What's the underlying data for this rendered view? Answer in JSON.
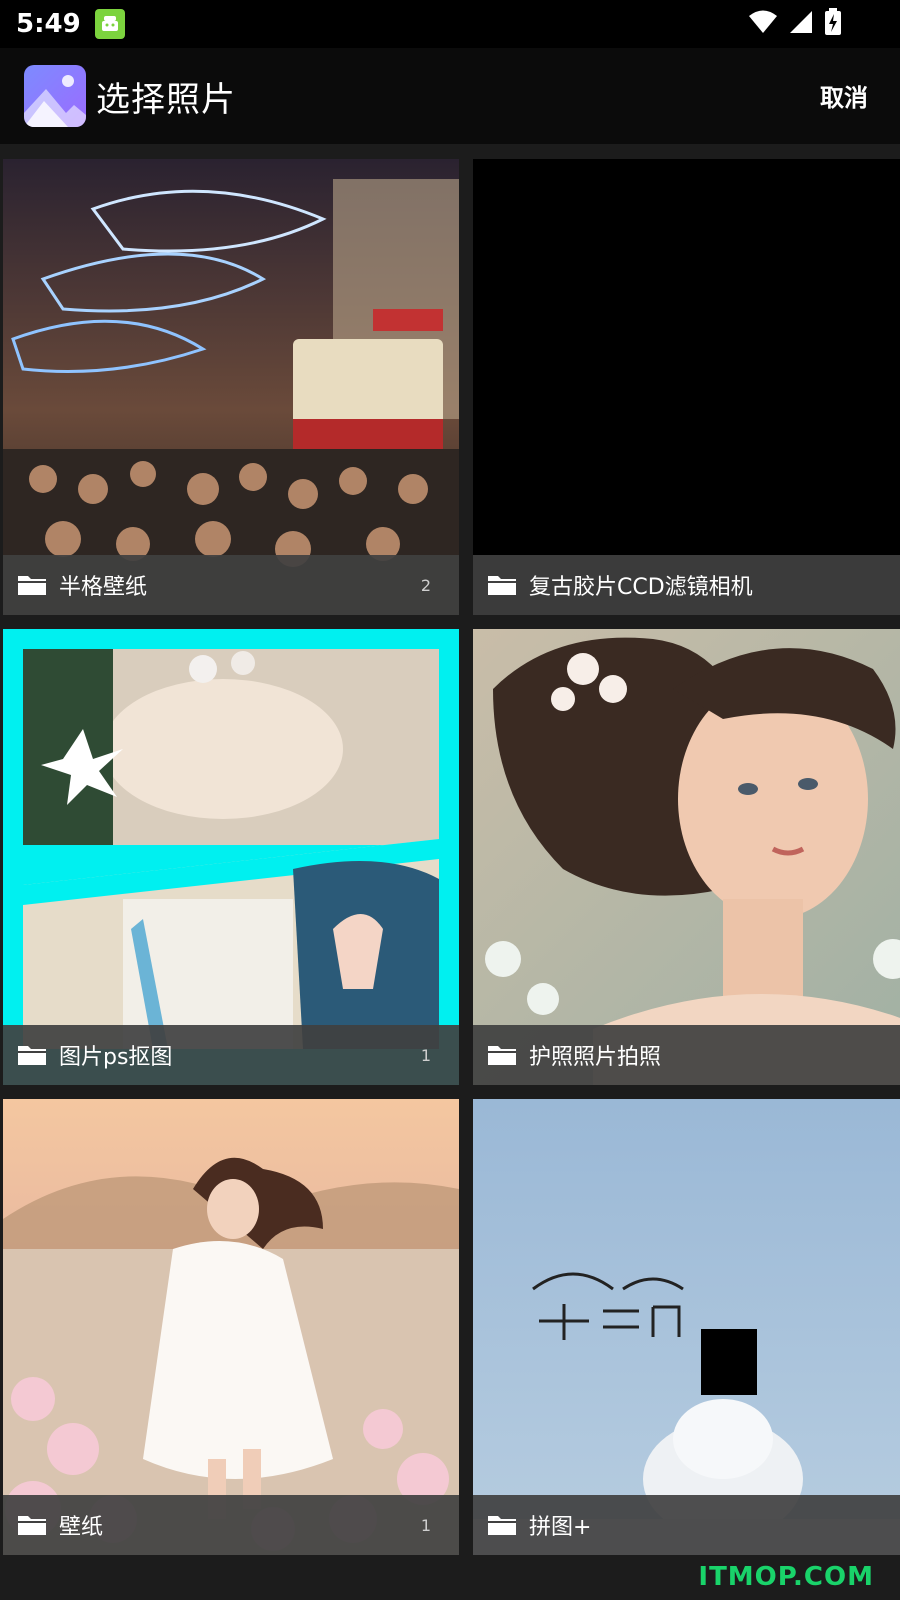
{
  "status_bar": {
    "time": "5:49",
    "icons": [
      "android-app-icon",
      "wifi-icon",
      "signal-icon",
      "battery-charging-icon"
    ]
  },
  "app_bar": {
    "title": "选择照片",
    "cancel_label": "取消",
    "logo_icon": "gallery-icon"
  },
  "albums": [
    {
      "name": "半格壁纸",
      "count": "2",
      "thumbnail": "street-night-tram-photo"
    },
    {
      "name": "复古胶片CCD滤镜相机",
      "count": "",
      "thumbnail": "black-empty"
    },
    {
      "name": "图片ps抠图",
      "count": "1",
      "thumbnail": "cyan-framed-collage-photo"
    },
    {
      "name": "护照照片拍照",
      "count": "",
      "thumbnail": "portrait-painting-photo"
    },
    {
      "name": "壁纸",
      "count": "1",
      "thumbnail": "girl-flower-field-illustration"
    },
    {
      "name": "拼图+",
      "count": "",
      "thumbnail": "thank-you-sky-tree-photo"
    }
  ],
  "watermark": "ITMOP.COM",
  "colors": {
    "accent_cyan": "#00f0f0",
    "watermark_green": "#19d36a",
    "footer_gray": "#404040"
  }
}
